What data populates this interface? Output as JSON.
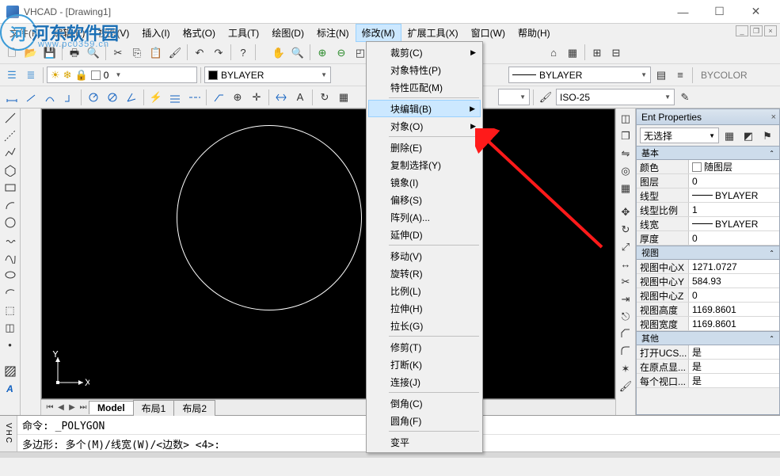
{
  "window": {
    "title": "VHCAD - [Drawing1]"
  },
  "watermark": {
    "text": "河东软件园",
    "url": "www.pc0359.cn"
  },
  "menu": {
    "items": [
      "文件(F)",
      "编辑(E)",
      "视图(V)",
      "插入(I)",
      "格式(O)",
      "工具(T)",
      "绘图(D)",
      "标注(N)",
      "修改(M)",
      "扩展工具(X)",
      "窗口(W)",
      "帮助(H)"
    ],
    "activeIndex": 8
  },
  "layerCombo": {
    "value": "0"
  },
  "colorCombo": {
    "value": "BYLAYER"
  },
  "ltCombo": {
    "value": "BYLAYER"
  },
  "bycolor": "BYCOLOR",
  "dimStyle": {
    "value": "ISO-25"
  },
  "tabs": {
    "items": [
      "Model",
      "布局1",
      "布局2"
    ],
    "active": 0
  },
  "dropdown": {
    "groups": [
      [
        {
          "label": "裁剪(C)",
          "sub": true
        },
        {
          "label": "对象特性(P)"
        },
        {
          "label": "特性匹配(M)"
        }
      ],
      [
        {
          "label": "块编辑(B)",
          "sub": true,
          "hl": true
        },
        {
          "label": "对象(O)",
          "sub": true
        }
      ],
      [
        {
          "label": "删除(E)"
        },
        {
          "label": "复制选择(Y)"
        },
        {
          "label": "镜象(I)"
        },
        {
          "label": "偏移(S)"
        },
        {
          "label": "阵列(A)..."
        },
        {
          "label": "延伸(D)"
        }
      ],
      [
        {
          "label": "移动(V)"
        },
        {
          "label": "旋转(R)"
        },
        {
          "label": "比例(L)"
        },
        {
          "label": "拉伸(H)"
        },
        {
          "label": "拉长(G)"
        }
      ],
      [
        {
          "label": "修剪(T)"
        },
        {
          "label": "打断(K)"
        },
        {
          "label": "连接(J)"
        }
      ],
      [
        {
          "label": "倒角(C)"
        },
        {
          "label": "圆角(F)"
        }
      ],
      [
        {
          "label": "变平"
        }
      ]
    ]
  },
  "props": {
    "title": "Ent Properties",
    "selection": "无选择",
    "sections": [
      {
        "name": "基本",
        "rows": [
          {
            "k": "颜色",
            "v": "随图层",
            "sw": true
          },
          {
            "k": "图层",
            "v": "0"
          },
          {
            "k": "线型",
            "v": "BYLAYER",
            "line": true
          },
          {
            "k": "线型比例",
            "v": "1"
          },
          {
            "k": "线宽",
            "v": "BYLAYER",
            "line": true
          },
          {
            "k": "厚度",
            "v": "0"
          }
        ]
      },
      {
        "name": "视图",
        "rows": [
          {
            "k": "视图中心X",
            "v": "1271.0727"
          },
          {
            "k": "视图中心Y",
            "v": "584.93"
          },
          {
            "k": "视图中心Z",
            "v": "0"
          },
          {
            "k": "视图高度",
            "v": "1169.8601"
          },
          {
            "k": "视图宽度",
            "v": "1169.8601"
          }
        ]
      },
      {
        "name": "其他",
        "rows": [
          {
            "k": "打开UCS...",
            "v": "是"
          },
          {
            "k": "在原点显...",
            "v": "是"
          },
          {
            "k": "每个视口...",
            "v": "是"
          }
        ]
      }
    ]
  },
  "cmd": {
    "gutter": "VHC",
    "line1": "命令: _POLYGON",
    "line2": "多边形:  多个(M)/线宽(W)/<边数> <4>:"
  },
  "ucs": {
    "x": "X",
    "y": "Y"
  }
}
